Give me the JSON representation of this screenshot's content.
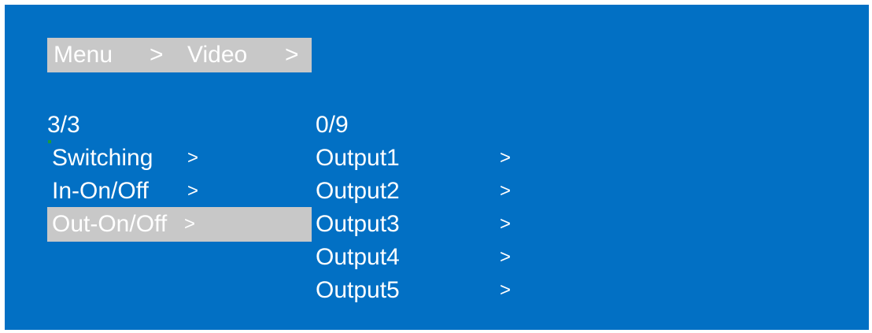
{
  "breadcrumb": {
    "menu": "Menu",
    "sep1": ">",
    "video": "Video",
    "sep2": ">"
  },
  "left_panel": {
    "counter": "3/3",
    "items": [
      {
        "label": "Switching",
        "arrow": ">"
      },
      {
        "label": "In-On/Off",
        "arrow": ">"
      },
      {
        "label": "Out-On/Off",
        "arrow": ">"
      }
    ],
    "selected_index": 2
  },
  "right_panel": {
    "counter": "0/9",
    "items": [
      {
        "label": "Output1",
        "arrow": ">"
      },
      {
        "label": "Output2",
        "arrow": ">"
      },
      {
        "label": "Output3",
        "arrow": ">"
      },
      {
        "label": "Output4",
        "arrow": ">"
      },
      {
        "label": "Output5",
        "arrow": ">"
      }
    ]
  },
  "colors": {
    "background": "#0270c4",
    "highlight": "#c8c8c8",
    "text": "#ffffff"
  }
}
